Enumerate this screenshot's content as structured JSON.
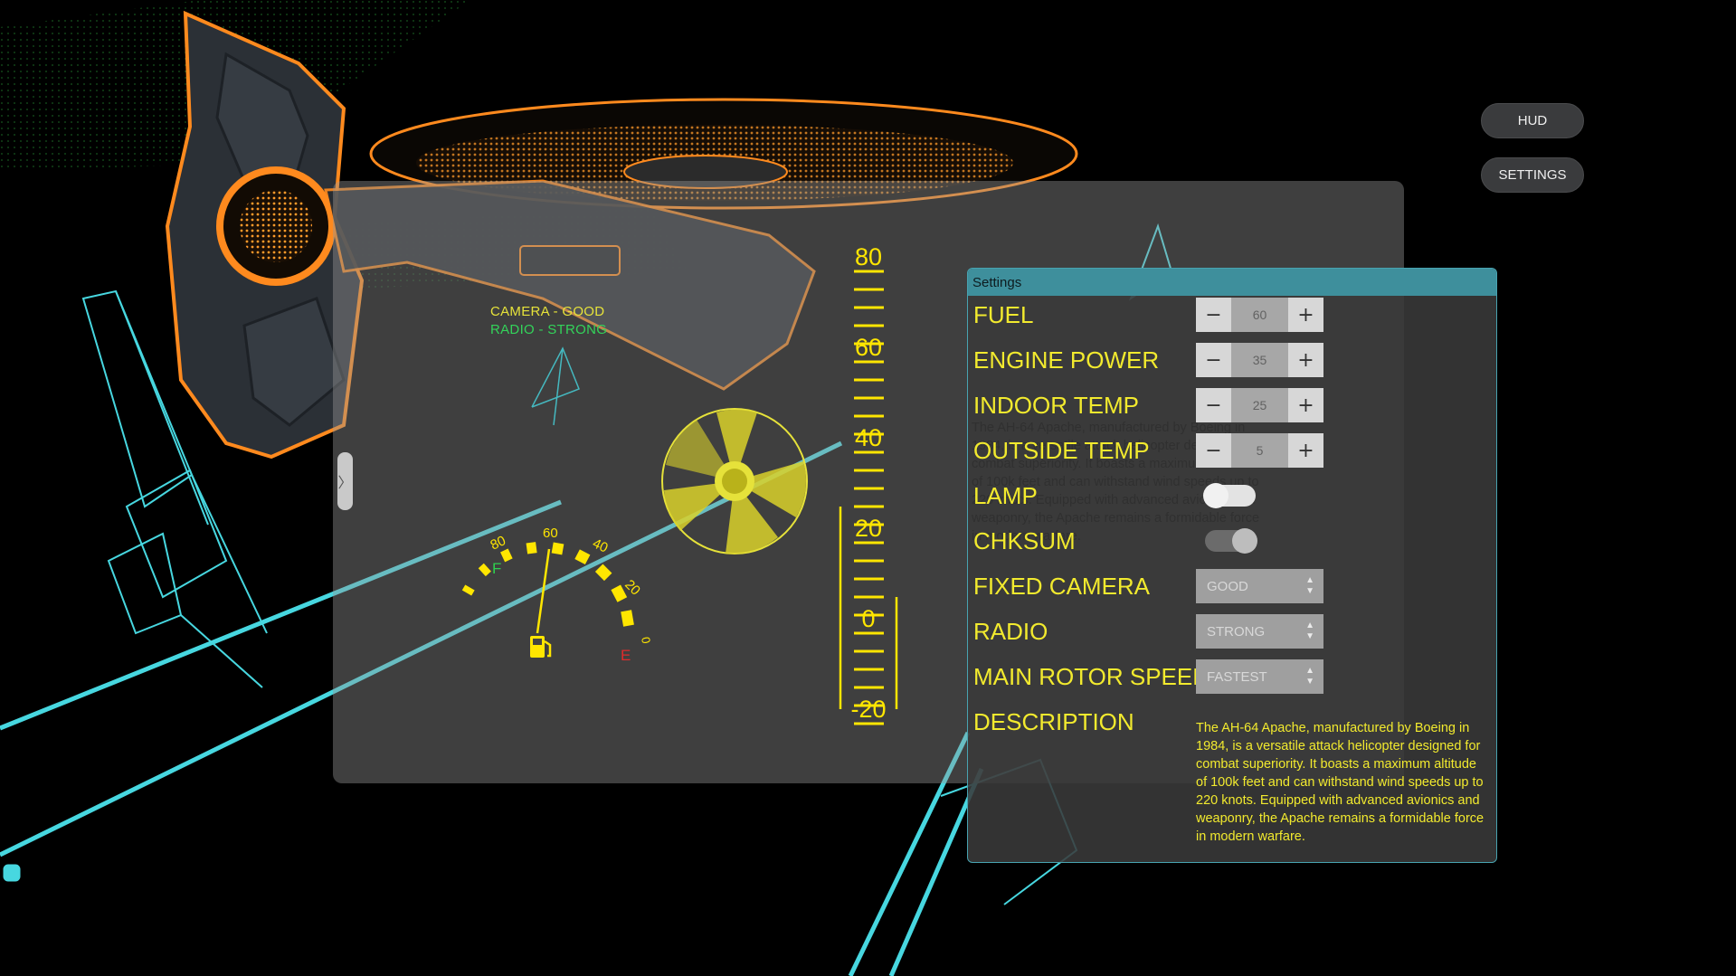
{
  "top_buttons": {
    "hud": "HUD",
    "settings": "SETTINGS"
  },
  "hud": {
    "camera_status": "CAMERA - GOOD",
    "radio_status": "RADIO - STRONG",
    "handle_glyph": "〉",
    "altitude_scale": [
      "80",
      "60",
      "40",
      "20",
      "0",
      "-20"
    ],
    "fuel_gauge": {
      "scale_labels": [
        "80",
        "60",
        "40",
        "20",
        "0"
      ],
      "full_label": "F",
      "empty_label": "E",
      "fuel_icon": "fuel-pump-icon"
    },
    "colors": {
      "hud_yellow": "#f2ea2e",
      "wireframe_cyan": "#47d7e0",
      "neon_orange": "#ff8a1e"
    }
  },
  "settings": {
    "title": "Settings",
    "labels": {
      "fuel": "FUEL",
      "engine_power": "ENGINE POWER",
      "indoor_temp": "INDOOR TEMP",
      "outside_temp": "OUTSIDE TEMP",
      "lamp": "LAMP",
      "chksum": "CHKSUM",
      "fixed_camera": "FIXED CAMERA",
      "radio": "RADIO",
      "main_rotor_speed": "MAIN ROTOR SPEED",
      "description": "DESCRIPTION"
    },
    "values": {
      "fuel": "60",
      "engine_power": "35",
      "indoor_temp": "25",
      "outside_temp": "5",
      "lamp_on": false,
      "chksum_on": true,
      "fixed_camera": "GOOD",
      "radio": "STRONG",
      "main_rotor_speed": "FASTEST"
    },
    "stepper_minus": "−",
    "stepper_plus": "+",
    "description_text": "The AH-64 Apache, manufactured by Boeing in 1984, is a versatile attack helicopter designed for combat superiority. It boasts a maximum altitude of 100k feet and can withstand wind speeds up to 220 knots. Equipped with advanced avionics and weaponry, the Apache remains a formidable force in modern warfare."
  }
}
